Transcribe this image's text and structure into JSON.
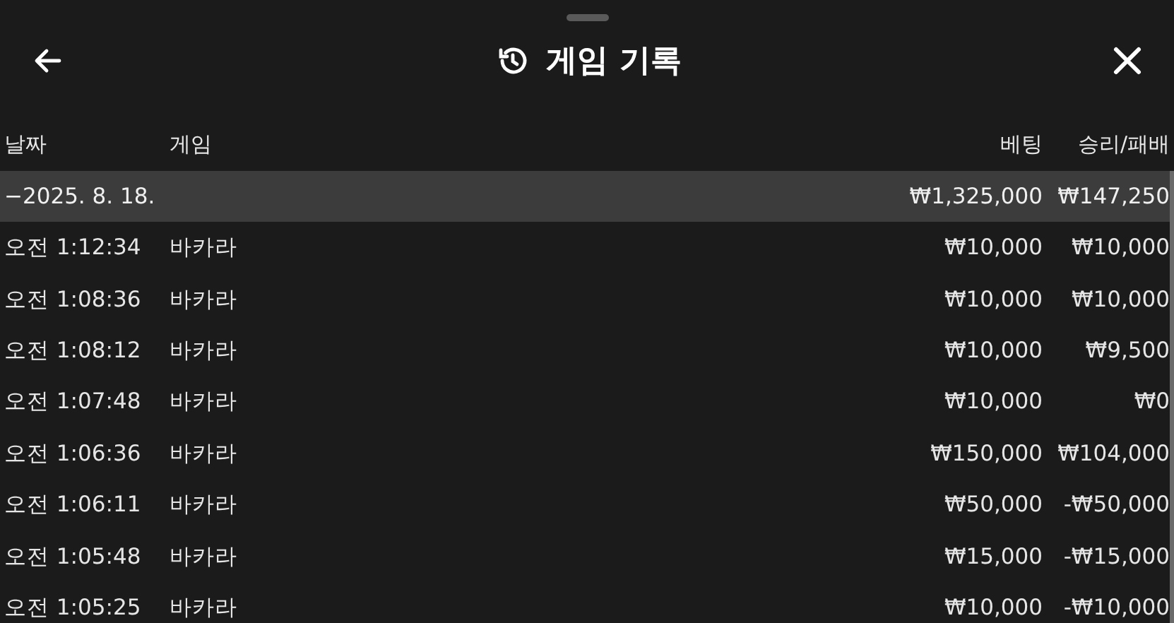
{
  "header": {
    "title": "게임 기록"
  },
  "table": {
    "columns": [
      "날짜",
      "게임",
      "베팅",
      "승리/패배"
    ],
    "groups": [
      {
        "date": "−2025. 8. 18.",
        "bet_total": "₩1,325,000",
        "result_total": "₩147,250",
        "rows": [
          {
            "time": "오전 1:12:34",
            "game": "바카라",
            "bet": "₩10,000",
            "result": "₩10,000"
          },
          {
            "time": "오전 1:08:36",
            "game": "바카라",
            "bet": "₩10,000",
            "result": "₩10,000"
          },
          {
            "time": "오전 1:08:12",
            "game": "바카라",
            "bet": "₩10,000",
            "result": "₩9,500"
          },
          {
            "time": "오전 1:07:48",
            "game": "바카라",
            "bet": "₩10,000",
            "result": "₩0"
          },
          {
            "time": "오전 1:06:36",
            "game": "바카라",
            "bet": "₩150,000",
            "result": "₩104,000"
          },
          {
            "time": "오전 1:06:11",
            "game": "바카라",
            "bet": "₩50,000",
            "result": "-₩50,000"
          },
          {
            "time": "오전 1:05:48",
            "game": "바카라",
            "bet": "₩15,000",
            "result": "-₩15,000"
          },
          {
            "time": "오전 1:05:25",
            "game": "바카라",
            "bet": "₩10,000",
            "result": "-₩10,000"
          }
        ]
      }
    ]
  }
}
